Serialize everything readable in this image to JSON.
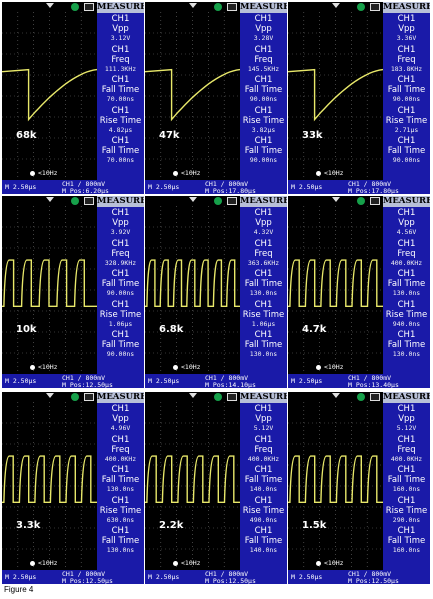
{
  "caption": "Figure 4",
  "panels": [
    {
      "resistor": "68k",
      "cells": [
        [
          "CH1",
          "Vpp",
          "3.12V"
        ],
        [
          "CH1",
          "Freq",
          "111.3KHz"
        ],
        [
          "CH1",
          "Fall Time",
          "70.00ns"
        ],
        [
          "CH1",
          "Rise Time",
          "4.82µs"
        ],
        [
          "CH1",
          "Fall Time",
          "70.00ns"
        ]
      ],
      "pos": "M Pos:6.20µs",
      "wave": "saw",
      "periods": 1
    },
    {
      "resistor": "47k",
      "cells": [
        [
          "CH1",
          "Vpp",
          "3.28V"
        ],
        [
          "CH1",
          "Freq",
          "145.5KHz"
        ],
        [
          "CH1",
          "Fall Time",
          "90.00ns"
        ],
        [
          "CH1",
          "Rise Time",
          "3.82µs"
        ],
        [
          "CH1",
          "Fall Time",
          "90.00ns"
        ]
      ],
      "pos": "M Pos:17.80µs",
      "wave": "saw",
      "periods": 1
    },
    {
      "resistor": "33k",
      "cells": [
        [
          "CH1",
          "Vpp",
          "3.36V"
        ],
        [
          "CH1",
          "Freq",
          "183.8KHz"
        ],
        [
          "CH1",
          "Fall Time",
          "90.00ns"
        ],
        [
          "CH1",
          "Rise Time",
          "2.71µs"
        ],
        [
          "CH1",
          "Fall Time",
          "90.00ns"
        ]
      ],
      "pos": "M Pos:17.80µs",
      "wave": "saw",
      "periods": 1
    },
    {
      "resistor": "10k",
      "cells": [
        [
          "CH1",
          "Vpp",
          "3.92V"
        ],
        [
          "CH1",
          "Freq",
          "328.9KHz"
        ],
        [
          "CH1",
          "Fall Time",
          "90.00ns"
        ],
        [
          "CH1",
          "Rise Time",
          "1.06µs"
        ],
        [
          "CH1",
          "Fall Time",
          "90.00ns"
        ]
      ],
      "pos": "M Pos:12.50µs",
      "wave": "pulse",
      "periods": 5
    },
    {
      "resistor": "6.8k",
      "cells": [
        [
          "CH1",
          "Vpp",
          "4.32V"
        ],
        [
          "CH1",
          "Freq",
          "363.6KHz"
        ],
        [
          "CH1",
          "Fall Time",
          "130.0ns"
        ],
        [
          "CH1",
          "Rise Time",
          "1.06µs"
        ],
        [
          "CH1",
          "Fall Time",
          "130.0ns"
        ]
      ],
      "pos": "M Pos:14.10µs",
      "wave": "pulse",
      "periods": 7
    },
    {
      "resistor": "4.7k",
      "cells": [
        [
          "CH1",
          "Vpp",
          "4.56V"
        ],
        [
          "CH1",
          "Freq",
          "400.0KHz"
        ],
        [
          "CH1",
          "Fall Time",
          "130.0ns"
        ],
        [
          "CH1",
          "Rise Time",
          "940.0ns"
        ],
        [
          "CH1",
          "Fall Time",
          "130.0ns"
        ]
      ],
      "pos": "M Pos:13.40µs",
      "wave": "pulse",
      "periods": 6
    },
    {
      "resistor": "3.3k",
      "cells": [
        [
          "CH1",
          "Vpp",
          "4.96V"
        ],
        [
          "CH1",
          "Freq",
          "400.0KHz"
        ],
        [
          "CH1",
          "Fall Time",
          "130.0ns"
        ],
        [
          "CH1",
          "Rise Time",
          "630.0ns"
        ],
        [
          "CH1",
          "Fall Time",
          "130.0ns"
        ]
      ],
      "pos": "M Pos:12.50µs",
      "wave": "pulse",
      "periods": 6
    },
    {
      "resistor": "2.2k",
      "cells": [
        [
          "CH1",
          "Vpp",
          "5.12V"
        ],
        [
          "CH1",
          "Freq",
          "400.0KHz"
        ],
        [
          "CH1",
          "Fall Time",
          "140.0ns"
        ],
        [
          "CH1",
          "Rise Time",
          "490.0ns"
        ],
        [
          "CH1",
          "Fall Time",
          "140.0ns"
        ]
      ],
      "pos": "M Pos:12.50µs",
      "wave": "pulse",
      "periods": 6
    },
    {
      "resistor": "1.5k",
      "cells": [
        [
          "CH1",
          "Vpp",
          "5.12V"
        ],
        [
          "CH1",
          "Freq",
          "400.0KHz"
        ],
        [
          "CH1",
          "Fall Time",
          "160.0ns"
        ],
        [
          "CH1",
          "Rise Time",
          "290.0ns"
        ],
        [
          "CH1",
          "Fall Time",
          "160.0ns"
        ]
      ],
      "pos": "M Pos:12.50µs",
      "wave": "pulse",
      "periods": 6
    }
  ],
  "common": {
    "measure_header": "MEASURE",
    "timebase": "M 2.50µs",
    "channel": "CH1 / 800mV",
    "freq_indicator": "<10Hz"
  },
  "colors": {
    "trace": "#e8e86a",
    "grid": "#6a6a6a",
    "panel_side": "#1a1aa8",
    "run_indicator": "#16a04a"
  }
}
